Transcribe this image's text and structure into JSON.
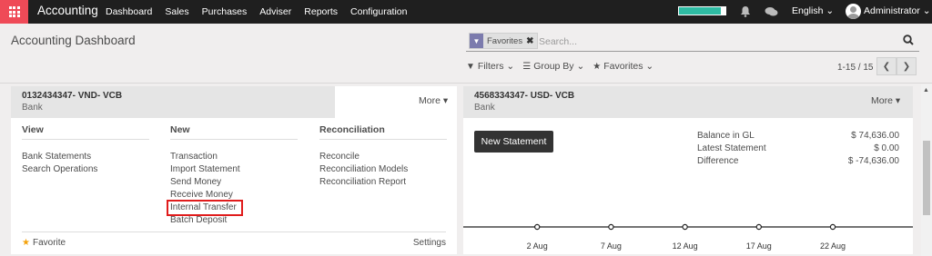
{
  "navbar": {
    "brand": "Accounting",
    "menu": [
      "Dashboard",
      "Sales",
      "Purchases",
      "Adviser",
      "Reports",
      "Configuration"
    ],
    "progress_fraction": 0.9,
    "progress_color": "#2ebba3",
    "language": "English",
    "user": "Administrator"
  },
  "control_panel": {
    "title": "Accounting Dashboard",
    "facet": "Favorites",
    "search_placeholder": "Search...",
    "filters_label": "Filters",
    "group_by_label": "Group By",
    "favorites_label": "Favorites",
    "pager": "1-15 / 15"
  },
  "card_vnd": {
    "title": "0132434347- VND- VCB",
    "subtitle": "Bank",
    "more": "More",
    "view_title": "View",
    "view_links": [
      "Bank Statements",
      "Search Operations"
    ],
    "new_title": "New",
    "new_links": [
      "Transaction",
      "Import Statement",
      "Send Money",
      "Receive Money",
      "Internal Transfer",
      "Batch Deposit"
    ],
    "reconciliation_title": "Reconciliation",
    "reconciliation_links": [
      "Reconcile",
      "Reconciliation Models",
      "Reconciliation Report"
    ],
    "favorite": "Favorite",
    "settings": "Settings"
  },
  "card_usd": {
    "title": "4568334347- USD- VCB",
    "subtitle": "Bank",
    "more": "More",
    "new_statement": "New Statement",
    "balances": [
      {
        "label": "Balance in GL",
        "value": "$ 74,636.00"
      },
      {
        "label": "Latest Statement",
        "value": "$ 0.00"
      },
      {
        "label": "Difference",
        "value": "$ -74,636.00"
      }
    ]
  },
  "chart_data": {
    "type": "line",
    "x": [
      "",
      "2 Aug",
      "7 Aug",
      "12 Aug",
      "17 Aug",
      "22 Aug",
      ""
    ],
    "tick_labels": [
      "2 Aug",
      "7 Aug",
      "12 Aug",
      "17 Aug",
      "22 Aug"
    ],
    "series": [
      {
        "values": [
          0,
          0,
          0,
          0,
          0,
          0,
          0
        ]
      }
    ],
    "title": "",
    "xlabel": "",
    "ylabel": ""
  }
}
